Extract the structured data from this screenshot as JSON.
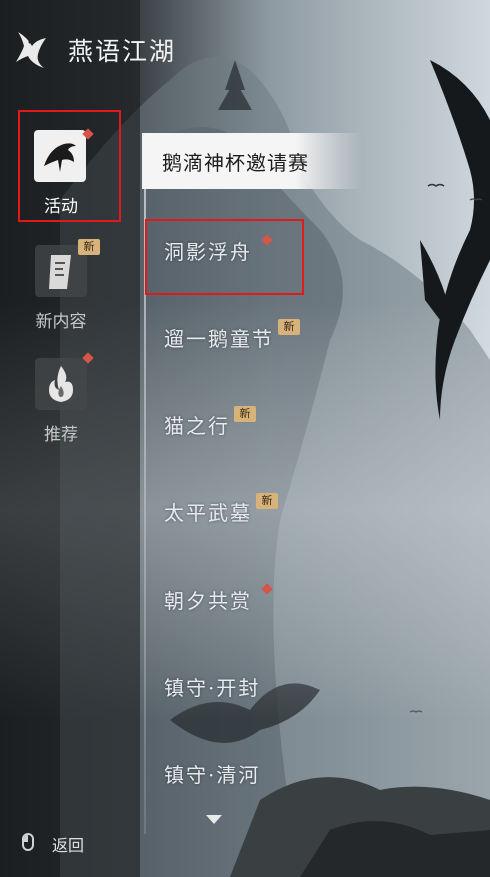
{
  "app": {
    "title": "燕语江湖"
  },
  "sidebar": {
    "items": [
      {
        "label": "活动",
        "icon": "crane-icon",
        "marker": "red-dot",
        "active": true
      },
      {
        "label": "新内容",
        "icon": "scroll-icon",
        "badge": "新"
      },
      {
        "label": "推荐",
        "icon": "flame-icon",
        "marker": "red-dot"
      }
    ]
  },
  "events": {
    "header": "鹅滴神杯邀请赛",
    "items": [
      {
        "label": "洞影浮舟",
        "marker": "red-dot"
      },
      {
        "label": "遛一鹅童节",
        "badge": "新"
      },
      {
        "label": "猫之行",
        "badge": "新"
      },
      {
        "label": "太平武墓",
        "badge": "新"
      },
      {
        "label": "朝夕共赏",
        "marker": "red-dot"
      },
      {
        "label": "镇守·开封"
      },
      {
        "label": "镇守·清河"
      }
    ]
  },
  "footer": {
    "back_label": "返回"
  },
  "colors": {
    "highlight": "#e01a1a",
    "badge": "#d7b27a",
    "dot": "#d5554a"
  }
}
